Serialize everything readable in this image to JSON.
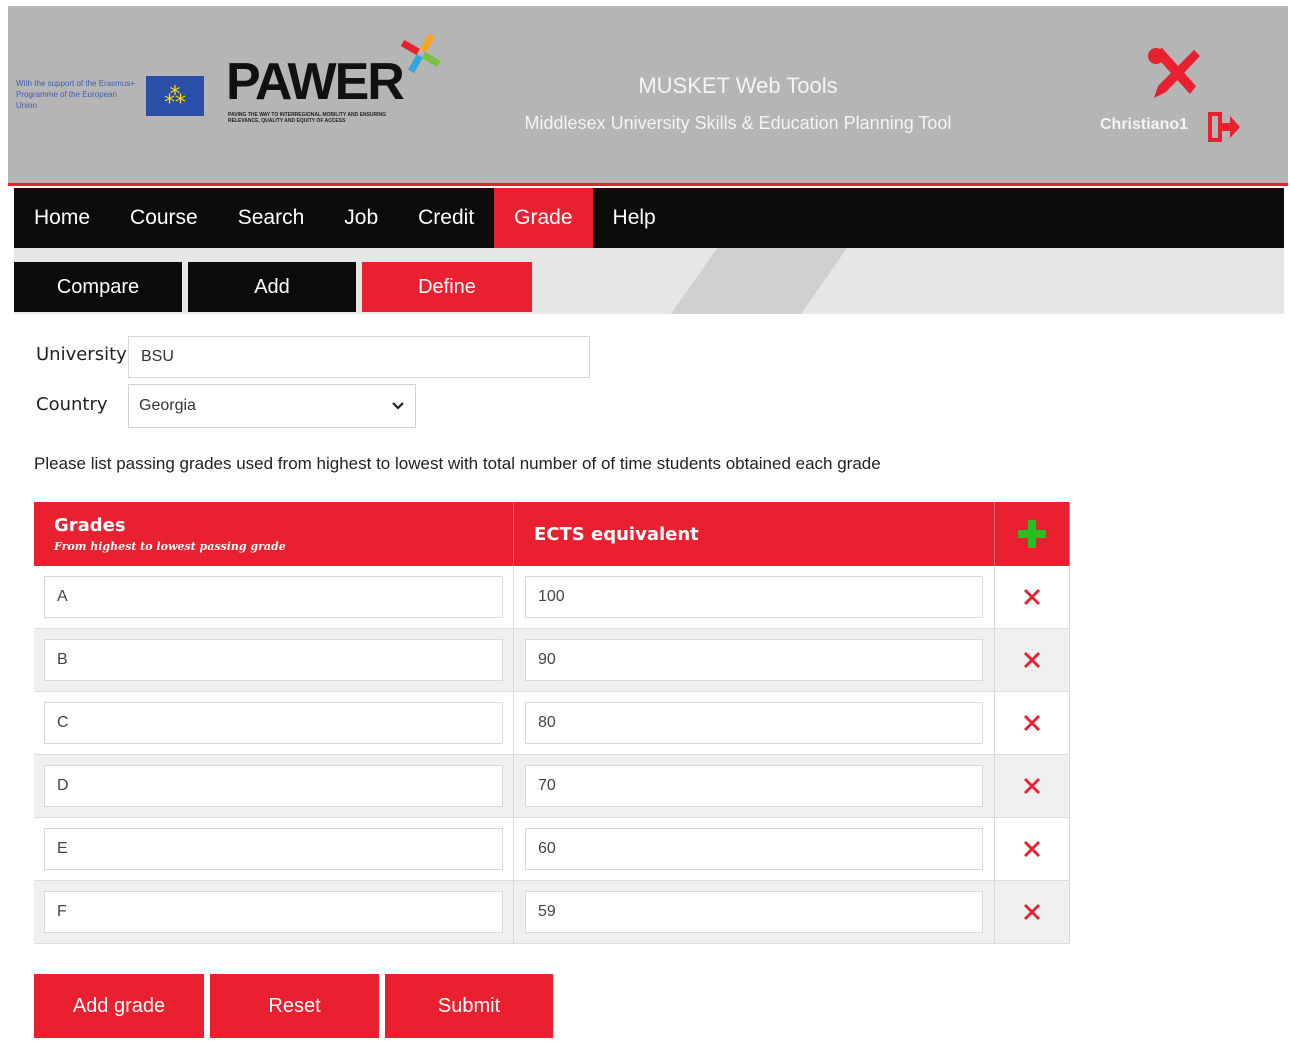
{
  "header": {
    "eu_support_text": "With the support of the Erasmus+ Programme of the European Union",
    "eu_flag_stars": "⁂",
    "logo_text": "PAWER",
    "logo_tagline": "PAVING THE WAY TO INTERREGIONAL MOBILITY AND ENSURING RELEVANCE, QUALITY AND EQUITY OF ACCESS",
    "app_title": "MUSKET Web Tools",
    "app_subtitle": "Middlesex University Skills & Education Planning Tool",
    "username": "Christiano1",
    "tools_icon": "wrench-screwdriver-icon",
    "logout_icon": "logout-icon"
  },
  "main_nav": [
    {
      "label": "Home",
      "active": false
    },
    {
      "label": "Course",
      "active": false
    },
    {
      "label": "Search",
      "active": false
    },
    {
      "label": "Job",
      "active": false
    },
    {
      "label": "Credit",
      "active": false
    },
    {
      "label": "Grade",
      "active": true
    },
    {
      "label": "Help",
      "active": false
    }
  ],
  "sub_nav": [
    {
      "label": "Compare",
      "active": false
    },
    {
      "label": "Add",
      "active": false
    },
    {
      "label": "Define",
      "active": true
    }
  ],
  "form": {
    "university_label": "University",
    "university_value": "BSU",
    "country_label": "Country",
    "country_value": "Georgia"
  },
  "instructions": "Please list passing grades used from highest to lowest with total number of of time students obtained each grade",
  "table": {
    "col_grades": "Grades",
    "col_grades_sub": "From highest to lowest passing grade",
    "col_ects": "ECTS equivalent",
    "add_icon": "plus-icon",
    "delete_icon": "delete-x-icon",
    "rows": [
      {
        "grade": "A",
        "ects": "100"
      },
      {
        "grade": "B",
        "ects": "90"
      },
      {
        "grade": "C",
        "ects": "80"
      },
      {
        "grade": "D",
        "ects": "70"
      },
      {
        "grade": "E",
        "ects": "60"
      },
      {
        "grade": "F",
        "ects": "59"
      }
    ]
  },
  "buttons": {
    "add_grade": "Add grade",
    "reset": "Reset",
    "submit": "Submit"
  },
  "colors": {
    "accent": "#e8202f",
    "nav_bg": "#0b0b0b",
    "header_bg": "#b5b5b5",
    "add_green": "#22c020"
  }
}
